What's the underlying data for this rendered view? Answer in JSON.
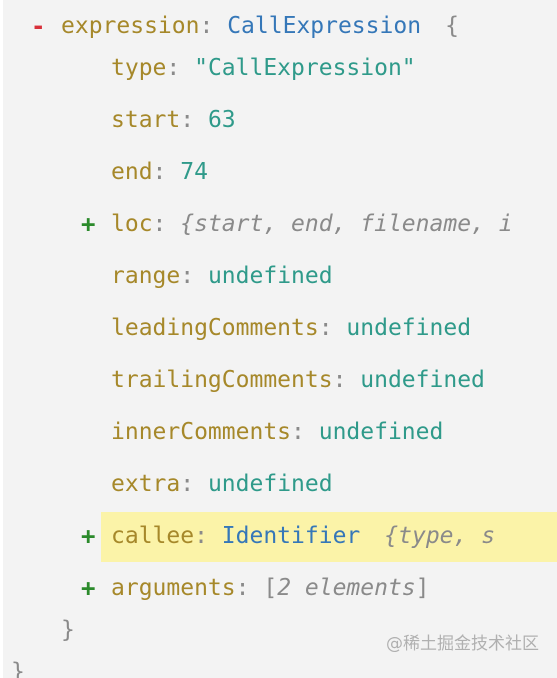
{
  "expression": {
    "toggle": "-",
    "key": "expression",
    "type_name": "CallExpression",
    "open_brace": "{"
  },
  "props": [
    {
      "key": "type",
      "value": "\"CallExpression\"",
      "kind": "string"
    },
    {
      "key": "start",
      "value": "63",
      "kind": "number"
    },
    {
      "key": "end",
      "value": "74",
      "kind": "number"
    }
  ],
  "loc": {
    "toggle": "+",
    "key": "loc",
    "summary": "{start, end, filename, i"
  },
  "undefined_props": [
    {
      "key": "range",
      "value": "undefined"
    },
    {
      "key": "leadingComments",
      "value": "undefined"
    },
    {
      "key": "trailingComments",
      "value": "undefined"
    },
    {
      "key": "innerComments",
      "value": "undefined"
    },
    {
      "key": "extra",
      "value": "undefined"
    }
  ],
  "callee": {
    "toggle": "+",
    "key": "callee",
    "type_name": "Identifier",
    "summary": "{type, s",
    "highlight_color": "#fbf3a8"
  },
  "arguments": {
    "toggle": "+",
    "key": "arguments",
    "open": "[",
    "summary": "2 elements",
    "close": "]"
  },
  "closing_brace": "}",
  "outer_closing_brace": "}",
  "watermark": "@稀土掘金技术社区",
  "colors": {
    "key": "#a6882a",
    "type": "#3577b8",
    "value": "#2f9a8a",
    "muted": "#8a8a8a",
    "minus": "#d8303a",
    "plus": "#2b8a2b"
  }
}
